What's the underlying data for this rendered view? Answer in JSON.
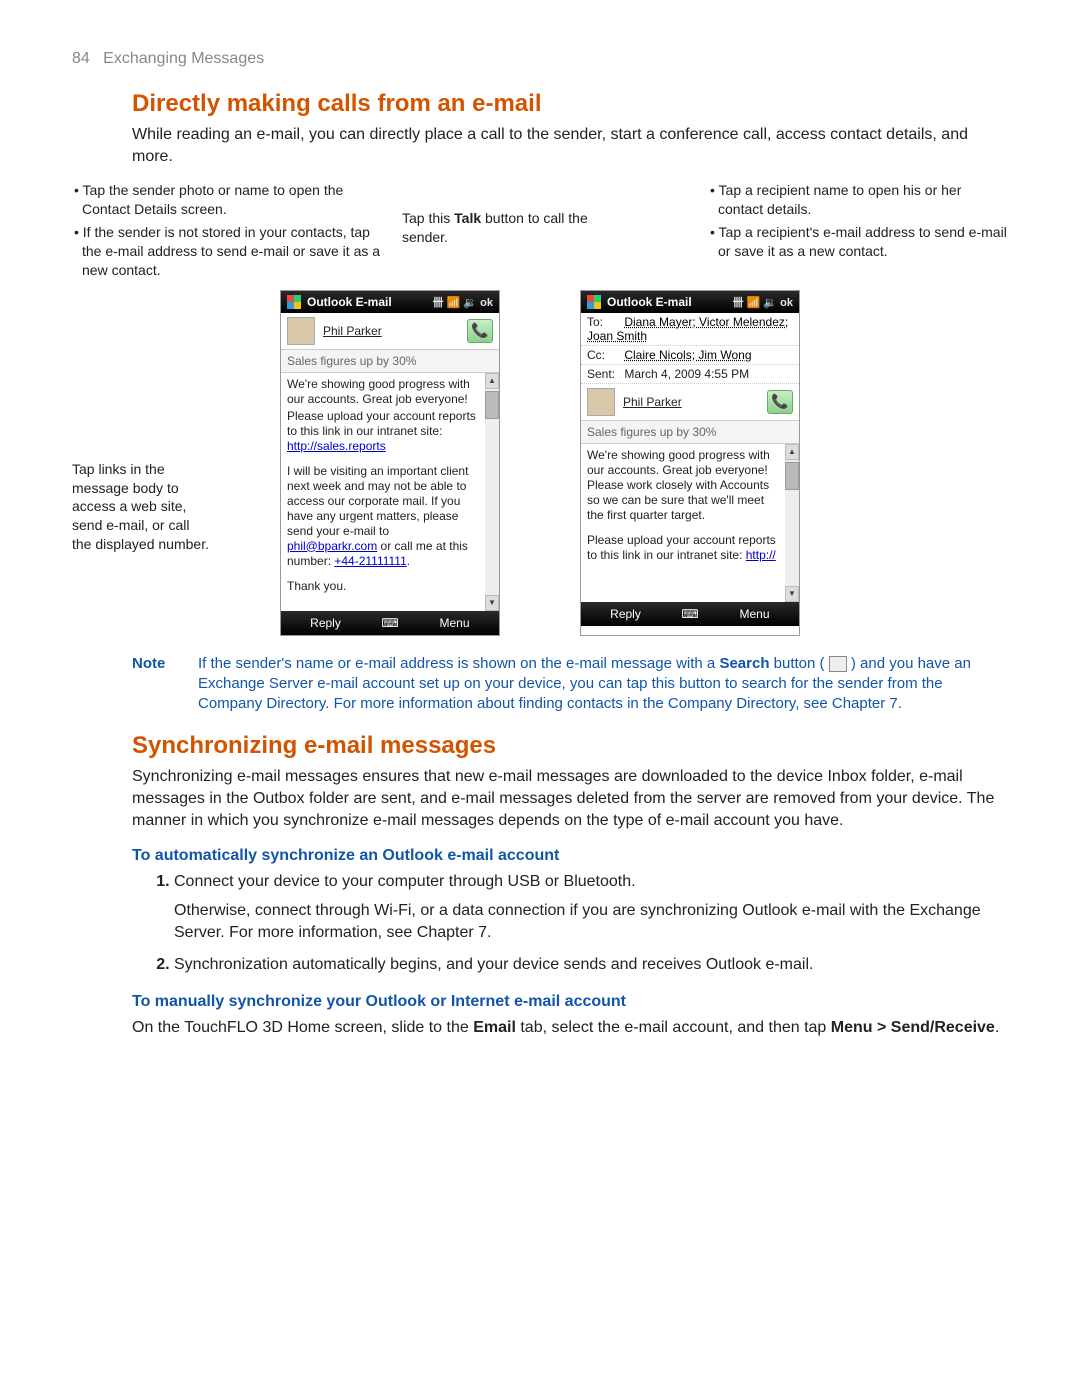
{
  "header": {
    "page_number": "84",
    "chapter": "Exchanging Messages"
  },
  "section1": {
    "title": "Directly making calls from an e-mail",
    "intro": "While reading an e-mail, you can directly place a call to the sender, start a conference call, access contact details, and more."
  },
  "callouts": {
    "left1": "Tap the sender photo or name to open the Contact Details screen.",
    "left2": "If the sender is not stored in your contacts, tap the e-mail address to send e-mail or save it as a new contact.",
    "mid_pre": "Tap this ",
    "mid_bold": "Talk",
    "mid_post": " button to call the sender.",
    "right1": "Tap a recipient name to open his or her contact details.",
    "right2": "Tap a recipient's e-mail address to send e-mail or save it as a new contact.",
    "side": "Tap links in the message body to access a web site, send e-mail, or call the displayed number."
  },
  "phone_left": {
    "title": "Outlook E-mail",
    "status_icons": "卌 📶 🔉 ok",
    "sender": "Phil Parker",
    "subject": "Sales figures up by 30%",
    "body_line1": "We're showing good progress with our accounts. Great job everyone!",
    "body_line2": "Please upload your account reports to this link in our intranet site: ",
    "link1": "http://sales.reports",
    "body_line3": "I will be visiting an important client next week and may not be able to access our corporate mail. If you have any urgent matters, please send your e-mail to ",
    "link2": "phil@bparkr.com",
    "body_line3b": " or call me at this number: ",
    "link3": "+44-21111111",
    "body_line4": "Thank you.",
    "sk_left": "Reply",
    "sk_mid": "⌨",
    "sk_right": "Menu"
  },
  "phone_right": {
    "title": "Outlook E-mail",
    "status_icons": "卌 📶 🔉 ok",
    "to_label": "To:",
    "to_names": "Diana Mayer; Victor Melendez; Joan Smith",
    "cc_label": "Cc:",
    "cc_names": "Claire Nicols; Jim Wong",
    "sent_label": "Sent:",
    "sent_value": "March 4, 2009 4:55 PM",
    "sender": "Phil Parker",
    "subject": "Sales figures up by 30%",
    "body_line1": "We're showing good progress with our accounts. Great job everyone! Please work closely with Accounts so we can be sure that we'll meet the first quarter target.",
    "body_line2": "Please upload your account reports to this link in our intranet site: ",
    "link1": "http://",
    "sk_left": "Reply",
    "sk_mid": "⌨",
    "sk_right": "Menu"
  },
  "note": {
    "label": "Note",
    "text_pre": "If the sender's name or e-mail address is shown on the e-mail message with a ",
    "bold1": "Search",
    "text_mid": " button ( ",
    "text_post": " ) and you have an Exchange Server e-mail account set up on your device, you can tap this button to search for the sender from the Company Directory. For more information about finding contacts in the Company Directory, see Chapter 7."
  },
  "section2": {
    "title": "Synchronizing e-mail messages",
    "intro": "Synchronizing e-mail messages ensures that new e-mail messages are downloaded to the device Inbox folder, e-mail messages in the Outbox folder are sent, and e-mail messages deleted from the server are removed from your device. The manner in which you synchronize e-mail messages depends on the type of e-mail account you have."
  },
  "sub1": {
    "title": "To automatically synchronize an Outlook e-mail account",
    "step1a": "Connect your device to your computer through USB or Bluetooth.",
    "step1b": "Otherwise, connect through Wi-Fi, or a data connection if you are synchronizing Outlook e-mail with the Exchange Server. For more information, see Chapter 7.",
    "step2": "Synchronization automatically begins, and your device sends and receives Outlook e-mail."
  },
  "sub2": {
    "title": "To manually synchronize your Outlook or Internet e-mail account",
    "text_pre": "On the TouchFLO 3D Home screen, slide to the ",
    "bold1": "Email",
    "text_mid": " tab, select the e-mail account, and then tap ",
    "bold2": "Menu > Send/Receive",
    "text_post": "."
  }
}
